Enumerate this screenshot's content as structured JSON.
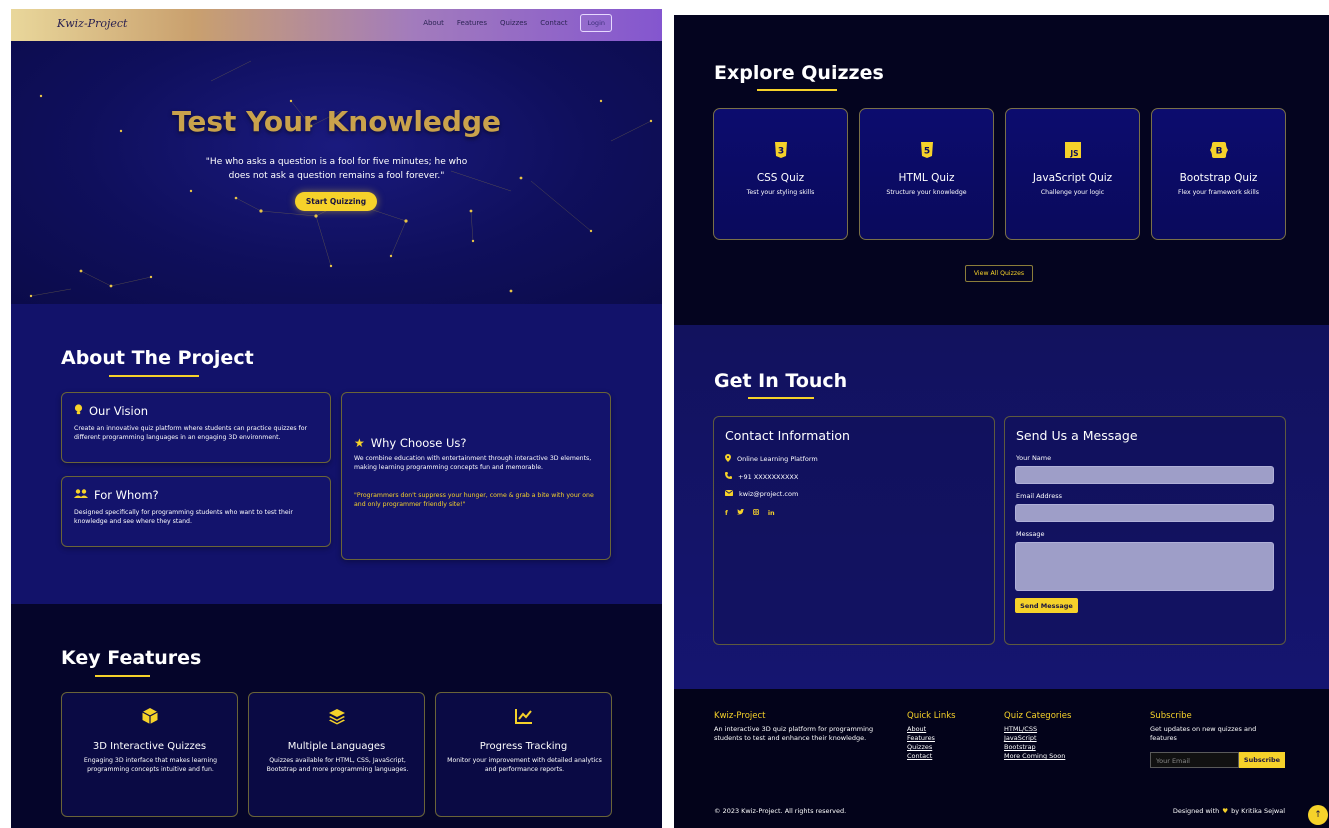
{
  "nav": {
    "logo": "Kwiz-Project",
    "links": [
      "About",
      "Features",
      "Quizzes",
      "Contact"
    ],
    "login": "Login"
  },
  "hero": {
    "title": "Test Your Knowledge",
    "quote_line1": "\"He who asks a question is a fool for five minutes; he who",
    "quote_line2": "does not ask a question remains a fool forever.\"",
    "button": "Start Quizzing"
  },
  "about": {
    "title": "About The Project",
    "vision": {
      "title": "Our Vision",
      "text": "Create an innovative quiz platform where students can practice quizzes for different programming languages in an engaging 3D environment."
    },
    "whom": {
      "title": "For Whom?",
      "text": "Designed specifically for programming students who want to test their knowledge and see where they stand."
    },
    "why": {
      "title": "Why Choose Us?",
      "text": "We combine education with entertainment through interactive 3D elements, making learning programming concepts fun and memorable.",
      "quote": "\"Programmers don't suppress your hunger, come & grab a bite with your one and only programmer friendly site!\""
    }
  },
  "features": {
    "title": "Key Features",
    "items": [
      {
        "title": "3D Interactive Quizzes",
        "desc": "Engaging 3D interface that makes learning programming concepts intuitive and fun.",
        "icon": "cube-icon"
      },
      {
        "title": "Multiple Languages",
        "desc": "Quizzes available for HTML, CSS, JavaScript, Bootstrap and more programming languages.",
        "icon": "layers-icon"
      },
      {
        "title": "Progress Tracking",
        "desc": "Monitor your improvement with detailed analytics and performance reports.",
        "icon": "chart-line-icon"
      }
    ]
  },
  "quizzes": {
    "title": "Explore Quizzes",
    "items": [
      {
        "title": "CSS Quiz",
        "desc": "Test your styling skills",
        "badge": "3",
        "icon": "css3-icon"
      },
      {
        "title": "HTML Quiz",
        "desc": "Structure your knowledge",
        "badge": "5",
        "icon": "html5-icon"
      },
      {
        "title": "JavaScript Quiz",
        "desc": "Challenge your logic",
        "badge": "JS",
        "icon": "javascript-icon"
      },
      {
        "title": "Bootstrap Quiz",
        "desc": "Flex your framework skills",
        "badge": "B",
        "icon": "bootstrap-icon"
      }
    ],
    "view_all": "View All Quizzes"
  },
  "contact": {
    "title": "Get In Touch",
    "info": {
      "title": "Contact Information",
      "location": "Online Learning Platform",
      "phone": "+91 XXXXXXXXXX",
      "email": "kwiz@project.com",
      "socials": [
        "f",
        "in"
      ]
    },
    "form": {
      "title": "Send Us a Message",
      "name_label": "Your Name",
      "email_label": "Email Address",
      "message_label": "Message",
      "button": "Send Message"
    }
  },
  "footer": {
    "brand": "Kwiz-Project",
    "brand_text": "An interactive 3D quiz platform for programming students to test and enhance their knowledge.",
    "quick_title": "Quick Links",
    "quick_links": [
      "About",
      "Features",
      "Quizzes",
      "Contact"
    ],
    "cat_title": "Quiz Categories",
    "categories": [
      "HTML/CSS",
      "JavaScript",
      "Bootstrap",
      "More Coming Soon"
    ],
    "sub_title": "Subscribe",
    "sub_text": "Get updates on new quizzes and features",
    "sub_placeholder": "Your Email",
    "sub_button": "Subscribe",
    "copyright": "© 2023 Kwiz-Project. All rights reserved.",
    "credit_pre": "Designed with",
    "credit_post": "by Kritika Sejwal"
  },
  "colors": {
    "accent": "#f6d22a",
    "gold_title": "#c9a24c",
    "navy": "#12126a"
  }
}
